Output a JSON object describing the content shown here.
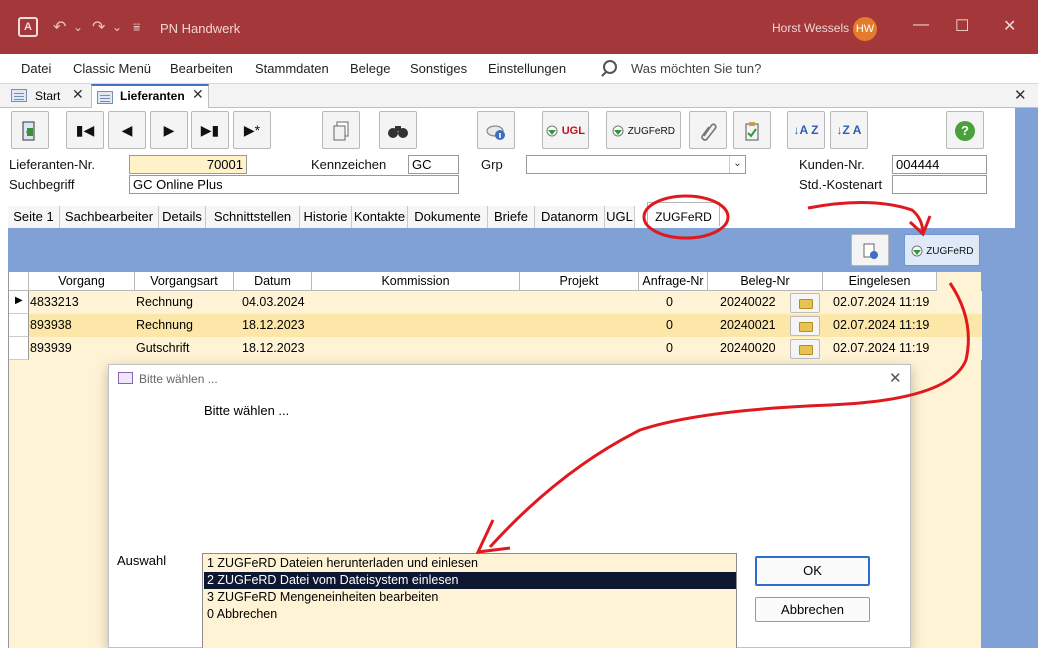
{
  "window": {
    "app_logo": "A",
    "title": "PN Handwerk",
    "user_name": "Horst Wessels",
    "user_initials": "HW",
    "minimize": "—",
    "maximize": "☐",
    "close": "✕",
    "undo": "↶",
    "redo": "↷",
    "dropdown": "⌄",
    "customize": "⩸"
  },
  "menu": {
    "items": [
      "Datei",
      "Classic Menü",
      "Bearbeiten",
      "Stammdaten",
      "Belege",
      "Sonstiges",
      "Einstellungen"
    ],
    "search_text": "Was möchten Sie tun?"
  },
  "doc_tabs": [
    {
      "label": "Start",
      "active": false
    },
    {
      "label": "Lieferanten",
      "active": true
    }
  ],
  "doc_close": "✕",
  "toolbar": {
    "nav": [
      "▮◀",
      "◀",
      "▶",
      "▶▮",
      "▶*"
    ],
    "ugl_label": "UGL",
    "zugferd_label": "ZUGFeRD",
    "help_symbol": "?",
    "sort_asc": "↓A Z",
    "sort_desc": "↓Z A"
  },
  "fields": {
    "lieferanten_nr_label": "Lieferanten-Nr.",
    "lieferanten_nr_value": "70001",
    "suchbegriff_label": "Suchbegriff",
    "suchbegriff_value": "GC Online Plus",
    "kennzeichen_label": "Kennzeichen",
    "kennzeichen_value": "GC",
    "grp_label": "Grp",
    "grp_value": "",
    "kunden_nr_label": "Kunden-Nr.",
    "kunden_nr_value": "004444",
    "kostenart_label": "Std.-Kostenart",
    "kostenart_value": ""
  },
  "subtabs": [
    "Seite 1",
    "Sachbearbeiter",
    "Details",
    "Schnittstellen",
    "Historie",
    "Kontakte",
    "Dokumente",
    "Briefe",
    "Datanorm",
    "UGL",
    "ZUGFeRD"
  ],
  "zugferd_button": "ZUGFeRD",
  "grid": {
    "columns": [
      "Vorgang",
      "Vorgangsart",
      "Datum",
      "Kommission",
      "Projekt",
      "Anfrage-Nr",
      "Beleg-Nr",
      "Eingelesen"
    ],
    "rows": [
      {
        "vorgang": "4833213",
        "art": "Rechnung",
        "datum": "04.03.2024",
        "kommission": "",
        "projekt": "",
        "anfrage": "0",
        "beleg": "20240022",
        "eingelesen": "02.07.2024 11:19"
      },
      {
        "vorgang": "893938",
        "art": "Rechnung",
        "datum": "18.12.2023",
        "kommission": "",
        "projekt": "",
        "anfrage": "0",
        "beleg": "20240021",
        "eingelesen": "02.07.2024 11:19"
      },
      {
        "vorgang": "893939",
        "art": "Gutschrift",
        "datum": "18.12.2023",
        "kommission": "",
        "projekt": "",
        "anfrage": "0",
        "beleg": "20240020",
        "eingelesen": "02.07.2024 11:19"
      }
    ]
  },
  "dialog": {
    "title": "Bitte wählen ...",
    "close": "✕",
    "prompt": "Bitte wählen ...",
    "auswahl_label": "Auswahl",
    "options": [
      "1 ZUGFeRD Dateien herunterladen und einlesen",
      "2 ZUGFeRD Datei vom Dateisystem einlesen",
      "3 ZUGFeRD Mengeneinheiten bearbeiten",
      "0 Abbrechen"
    ],
    "selected_index": 1,
    "ok_label": "OK",
    "cancel_label": "Abbrechen"
  },
  "colors": {
    "titlebar": "#a4373a",
    "grid_background": "#fff3d5",
    "selected_row": "#fde7a8",
    "list_selection": "#0d1731",
    "annotation_red": "#e0191f"
  }
}
